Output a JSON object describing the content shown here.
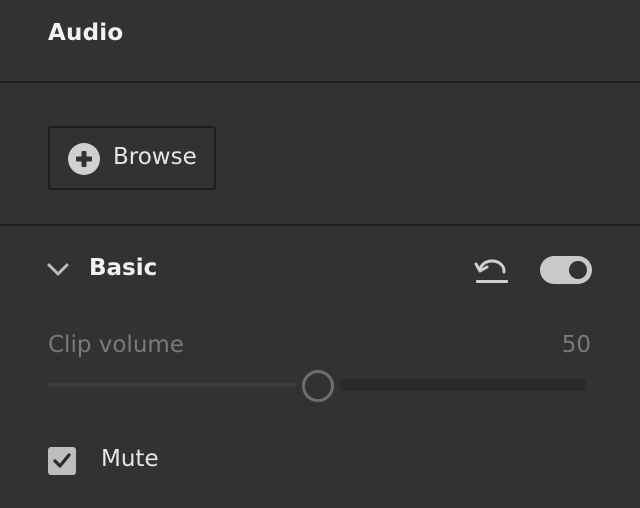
{
  "panel": {
    "title": "Audio"
  },
  "browse": {
    "label": "Browse",
    "icon": "plus-circle-icon"
  },
  "basic_section": {
    "title": "Basic",
    "expanded": true,
    "enabled": true,
    "reset_icon": "undo-icon"
  },
  "clip_volume": {
    "label": "Clip volume",
    "value": "50",
    "min": 0,
    "max": 100
  },
  "mute": {
    "label": "Mute",
    "checked": true
  }
}
